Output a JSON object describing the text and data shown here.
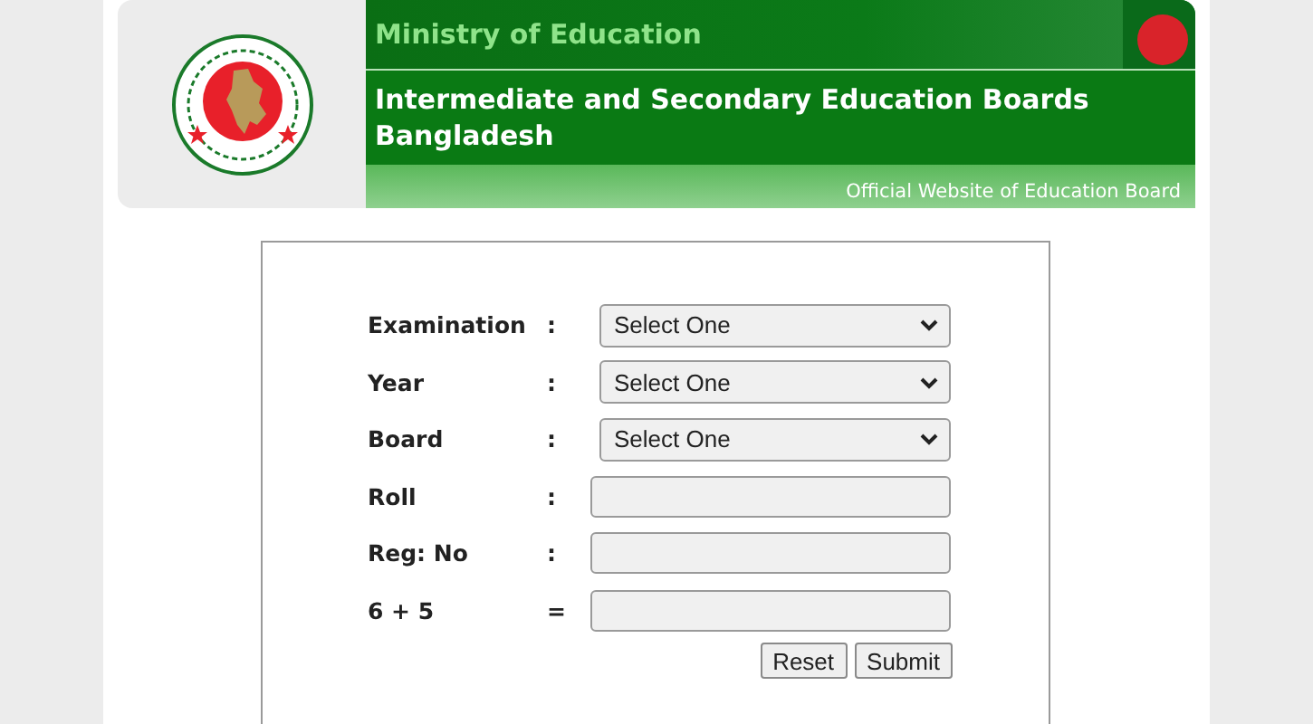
{
  "header": {
    "ministry": "Ministry of Education",
    "title": "Intermediate and Secondary Education Boards\nBangladesh",
    "tagline": "Official Website of Education Board"
  },
  "form": {
    "fields": [
      {
        "label": "Examination",
        "separator": ":",
        "kind": "select",
        "value": "Select One"
      },
      {
        "label": "Year",
        "separator": ":",
        "kind": "select",
        "value": "Select One"
      },
      {
        "label": "Board",
        "separator": ":",
        "kind": "select",
        "value": "Select One"
      },
      {
        "label": "Roll",
        "separator": ":",
        "kind": "text"
      },
      {
        "label": "Reg: No",
        "separator": ":",
        "kind": "text"
      },
      {
        "label": "6 + 5",
        "separator": "=",
        "kind": "text"
      }
    ],
    "buttons": [
      "Reset",
      "Submit"
    ]
  }
}
